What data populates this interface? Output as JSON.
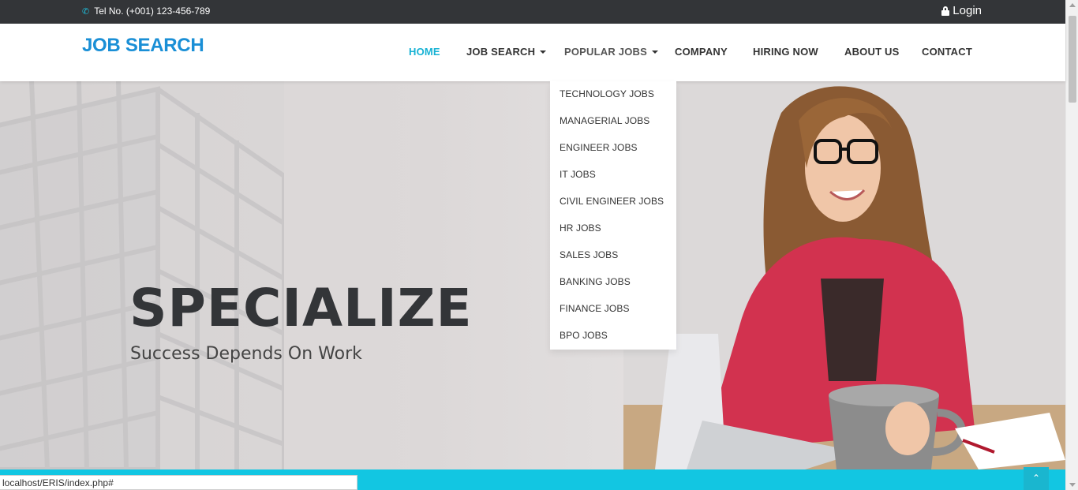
{
  "topbar": {
    "phone_text": "Tel No. (+001) 123-456-789",
    "login_label": "Login"
  },
  "header": {
    "brand": "JOB SEARCH",
    "nav": [
      {
        "label": "HOME"
      },
      {
        "label": "JOB SEARCH"
      },
      {
        "label": "POPULAR JOBS"
      },
      {
        "label": "COMPANY"
      },
      {
        "label": "HIRING NOW"
      },
      {
        "label": "ABOUT US"
      },
      {
        "label": "CONTACT"
      }
    ]
  },
  "dropdown": {
    "items": [
      "TECHNOLOGY JOBS",
      "MANAGERIAL JOBS",
      "ENGINEER JOBS",
      "IT JOBS",
      "CIVIL ENGINEER JOBS",
      "HR JOBS",
      "SALES JOBS",
      "BANKING JOBS",
      "FINANCE JOBS",
      "BPO JOBS"
    ]
  },
  "hero": {
    "title": "SPECIALIZE",
    "subtitle": "Success Depends On Work"
  },
  "status": {
    "url": "localhost/ERIS/index.php#"
  },
  "colors": {
    "accent": "#16b2d4",
    "brand": "#1a8fd6",
    "topbar": "#333538",
    "bottombar": "#12c6e2"
  }
}
